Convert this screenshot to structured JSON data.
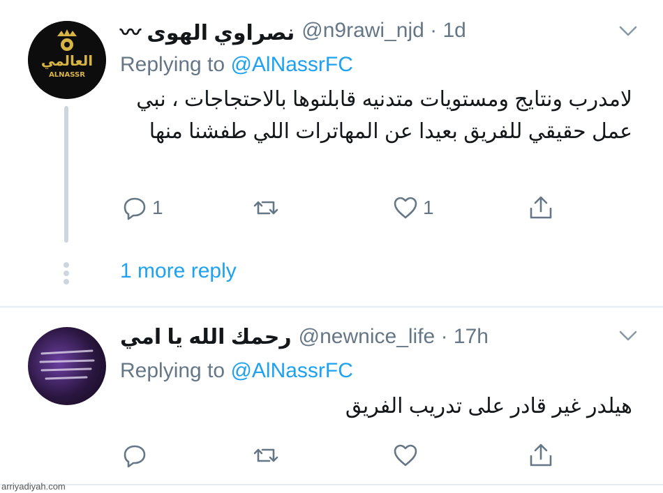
{
  "colors": {
    "link": "#1da1f2",
    "muted": "#657786",
    "text": "#14171a",
    "divider": "#e6ecf0"
  },
  "tweets": [
    {
      "display_name": "نصراوي الهوى 〰",
      "handle_time": "@n9rawi_njd · 1d",
      "replying_label": "Replying to",
      "replying_mention": "@AlNassrFC",
      "body": "لامدرب ونتايج ومستويات متدنيه قابلتوها بالاحتجاجات ، نبي عمل حقيقي للفريق بعيدا عن المهاترات اللي طفشنا منها",
      "avatar_text_ar": "العالمي",
      "avatar_text_en": "ALNASSR",
      "reply_count": "1",
      "retweet_count": "",
      "like_count": "1",
      "icons": [
        "reply-icon",
        "retweet-icon",
        "like-icon",
        "share-icon",
        "chevron-down-icon"
      ]
    },
    {
      "display_name": "رحمك الله يا امي",
      "handle_time": "@newnice_life · 17h",
      "replying_label": "Replying to",
      "replying_mention": "@AlNassrFC",
      "body": "هيلدر غير قادر  على تدريب الفريق",
      "reply_count": "",
      "retweet_count": "",
      "like_count": "",
      "icons": [
        "reply-icon",
        "retweet-icon",
        "like-icon",
        "share-icon",
        "chevron-down-icon"
      ]
    }
  ],
  "more_reply_label": "1 more reply",
  "watermark": "arriyadiyah.com"
}
